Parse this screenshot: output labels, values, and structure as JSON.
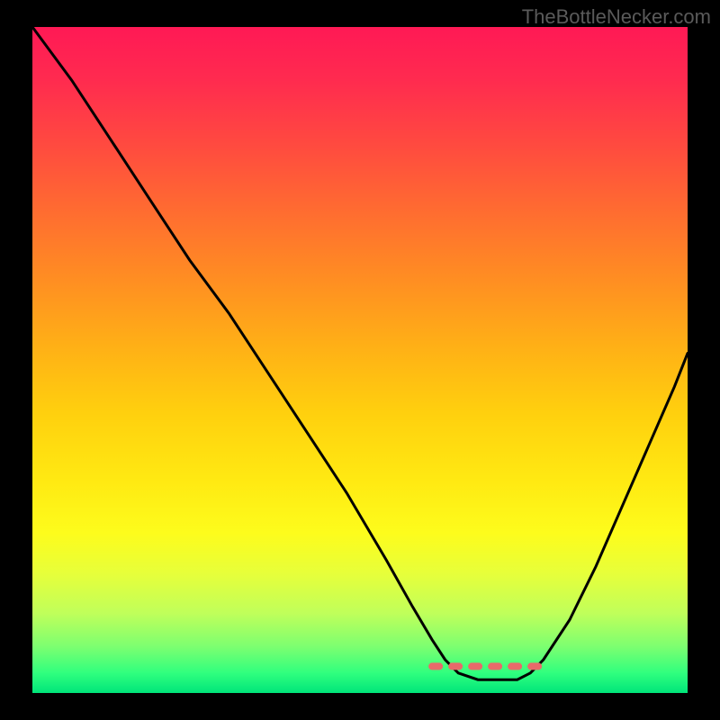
{
  "watermark": "TheBottleNecker.com",
  "chart_data": {
    "type": "line",
    "title": "",
    "xlabel": "",
    "ylabel": "",
    "xlim": [
      0,
      100
    ],
    "ylim": [
      0,
      100
    ],
    "note": "V-shaped bottleneck curve. Y≈100 means severe bottleneck (red), Y≈0 means none (green). Minimum/optimal region near x≈64–76. Values estimated from rendered curve; no axis ticks shown.",
    "x": [
      0,
      6,
      12,
      18,
      24,
      30,
      36,
      42,
      48,
      54,
      58,
      61,
      63,
      65,
      68,
      71,
      74,
      76,
      78,
      82,
      86,
      90,
      94,
      98,
      100
    ],
    "y": [
      100,
      92,
      83,
      74,
      65,
      57,
      48,
      39,
      30,
      20,
      13,
      8,
      5,
      3,
      2,
      2,
      2,
      3,
      5,
      11,
      19,
      28,
      37,
      46,
      51
    ],
    "optimal_band": {
      "x_start": 61,
      "x_end": 78,
      "y_level": 4
    },
    "gradient_stops": [
      {
        "pos": 0.0,
        "color": "#ff1955"
      },
      {
        "pos": 0.18,
        "color": "#ff4b3f"
      },
      {
        "pos": 0.38,
        "color": "#ff8e22"
      },
      {
        "pos": 0.58,
        "color": "#ffd00e"
      },
      {
        "pos": 0.76,
        "color": "#fdfc1c"
      },
      {
        "pos": 0.88,
        "color": "#c0ff5a"
      },
      {
        "pos": 0.97,
        "color": "#30ff7e"
      },
      {
        "pos": 1.0,
        "color": "#00e57a"
      }
    ]
  }
}
